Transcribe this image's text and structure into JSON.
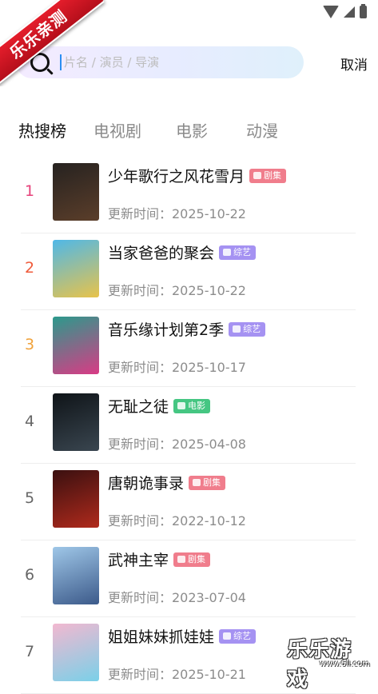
{
  "watermark": {
    "ribbon_text": "乐乐亲测",
    "logo_text": "乐乐游戏",
    "logo_sub": "www.6ll.com"
  },
  "search": {
    "placeholder": "片名 / 演员 / 导演",
    "value": "",
    "cancel_label": "取消"
  },
  "tabs": [
    {
      "label": "热搜榜",
      "active": true
    },
    {
      "label": "电视剧",
      "active": false
    },
    {
      "label": "电影",
      "active": false
    },
    {
      "label": "动漫",
      "active": false
    }
  ],
  "colors": {
    "rank1": "#e6417a",
    "rank2": "#ef5a3a",
    "rank3": "#f0a23b",
    "rank_other": "#666666",
    "badge_drama": "#f07d8c",
    "badge_variety": "#a592f2",
    "badge_movie": "#45c682"
  },
  "list": [
    {
      "rank": "1",
      "title": "少年歌行之风花雪月",
      "badge": "剧集",
      "badge_type": "drama",
      "time": "更新时间：2025-10-22",
      "poster": [
        "#262220",
        "#5b3e2a"
      ]
    },
    {
      "rank": "2",
      "title": "当家爸爸的聚会",
      "badge": "综艺",
      "badge_type": "variety",
      "time": "更新时间：2025-10-22",
      "poster": [
        "#4fb8e8",
        "#e8c34a"
      ]
    },
    {
      "rank": "3",
      "title": "音乐缘计划第2季",
      "badge": "综艺",
      "badge_type": "variety",
      "time": "更新时间：2025-10-17",
      "poster": [
        "#2b9a8c",
        "#d93b85"
      ]
    },
    {
      "rank": "4",
      "title": "无耻之徒",
      "badge": "电影",
      "badge_type": "movie",
      "time": "更新时间：2025-04-08",
      "poster": [
        "#0f1418",
        "#3a4650"
      ]
    },
    {
      "rank": "5",
      "title": "唐朝诡事录",
      "badge": "剧集",
      "badge_type": "drama",
      "time": "更新时间：2022-10-12",
      "poster": [
        "#3a1010",
        "#b02a1c"
      ]
    },
    {
      "rank": "6",
      "title": "武神主宰",
      "badge": "剧集",
      "badge_type": "drama",
      "time": "更新时间：2023-07-04",
      "poster": [
        "#9fc7e8",
        "#3c5a8a"
      ]
    },
    {
      "rank": "7",
      "title": "姐姐妹妹抓娃娃",
      "badge": "综艺",
      "badge_type": "variety",
      "time": "更新时间：2025-10-21",
      "poster": [
        "#f2b8d0",
        "#7ad0e8"
      ]
    }
  ]
}
